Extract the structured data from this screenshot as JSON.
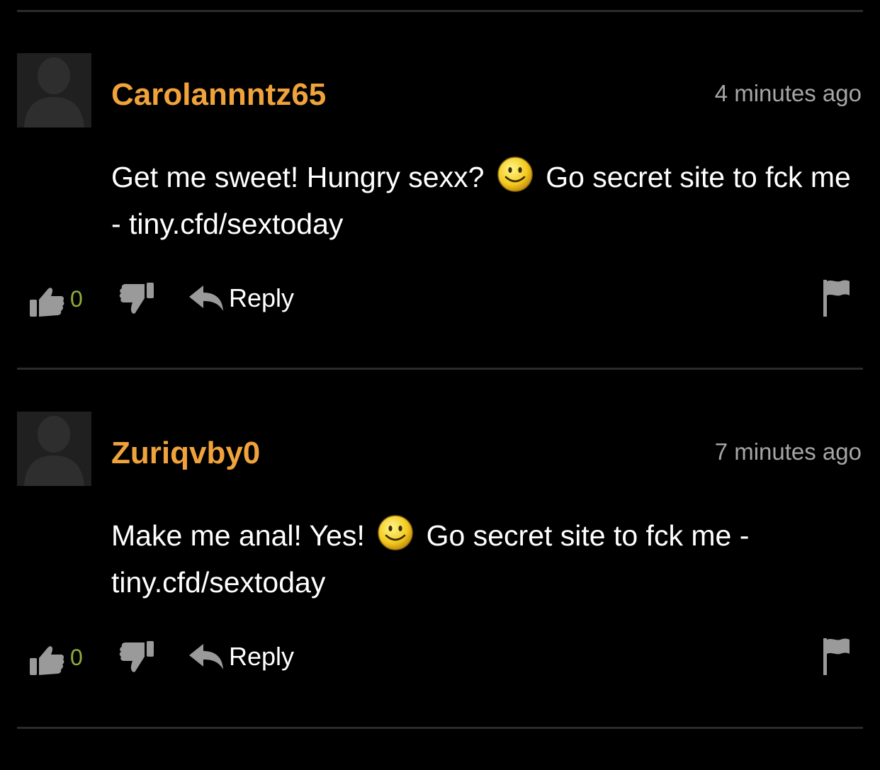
{
  "colors": {
    "background": "#000000",
    "username": "#f0a23b",
    "timestamp": "#a6a6a6",
    "vote_count": "#8fae3c",
    "icon_gray": "#9a9a9a",
    "divider": "#2b2b2b"
  },
  "comments": [
    {
      "username": "Carolannntz65",
      "timestamp": "4 minutes ago",
      "text_before_emoji": "Get me sweet! Hungry sexx?",
      "emoji": "smiley-face",
      "text_after_emoji": "Go secret site to fck me - tiny.cfd/sextoday",
      "vote_count": "0",
      "reply_label": "Reply"
    },
    {
      "username": "Zuriqvby0",
      "timestamp": "7 minutes ago",
      "text_before_emoji": "Make me anal! Yes!",
      "emoji": "smiley-face",
      "text_after_emoji": "Go secret site to fck me - tiny.cfd/sextoday",
      "vote_count": "0",
      "reply_label": "Reply"
    }
  ],
  "icons": {
    "avatar": "default-avatar-silhouette",
    "like": "thumbs-up-icon",
    "dislike": "thumbs-down-icon",
    "reply": "reply-arrow-icon",
    "report": "flag-icon"
  }
}
